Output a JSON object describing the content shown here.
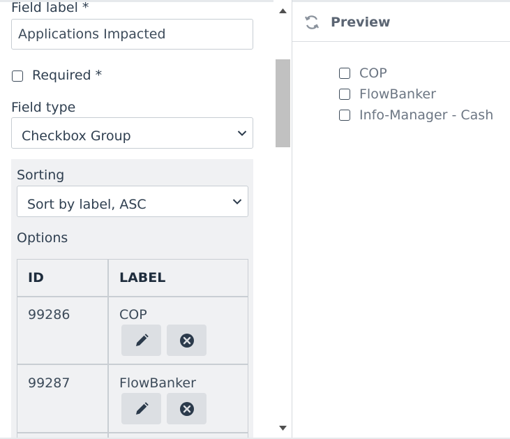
{
  "form": {
    "field_label_title": "Field label *",
    "field_label_value": "Applications Impacted",
    "required_label": "Required *",
    "field_type_title": "Field type",
    "field_type_value": "Checkbox Group",
    "sorting_title": "Sorting",
    "sorting_value": "Sort by label, ASC",
    "options_title": "Options"
  },
  "options_table": {
    "headers": [
      "ID",
      "LABEL"
    ],
    "rows": [
      {
        "id": "99286",
        "label": "COP"
      },
      {
        "id": "99287",
        "label": "FlowBanker"
      }
    ]
  },
  "preview": {
    "title": "Preview",
    "items": [
      "COP",
      "FlowBanker",
      "Info-Manager - Cash"
    ]
  },
  "icons": {
    "edit": "pencil-icon",
    "delete": "close-circle-icon",
    "refresh": "refresh-icon",
    "dropdown": "chevron-down-icon"
  }
}
